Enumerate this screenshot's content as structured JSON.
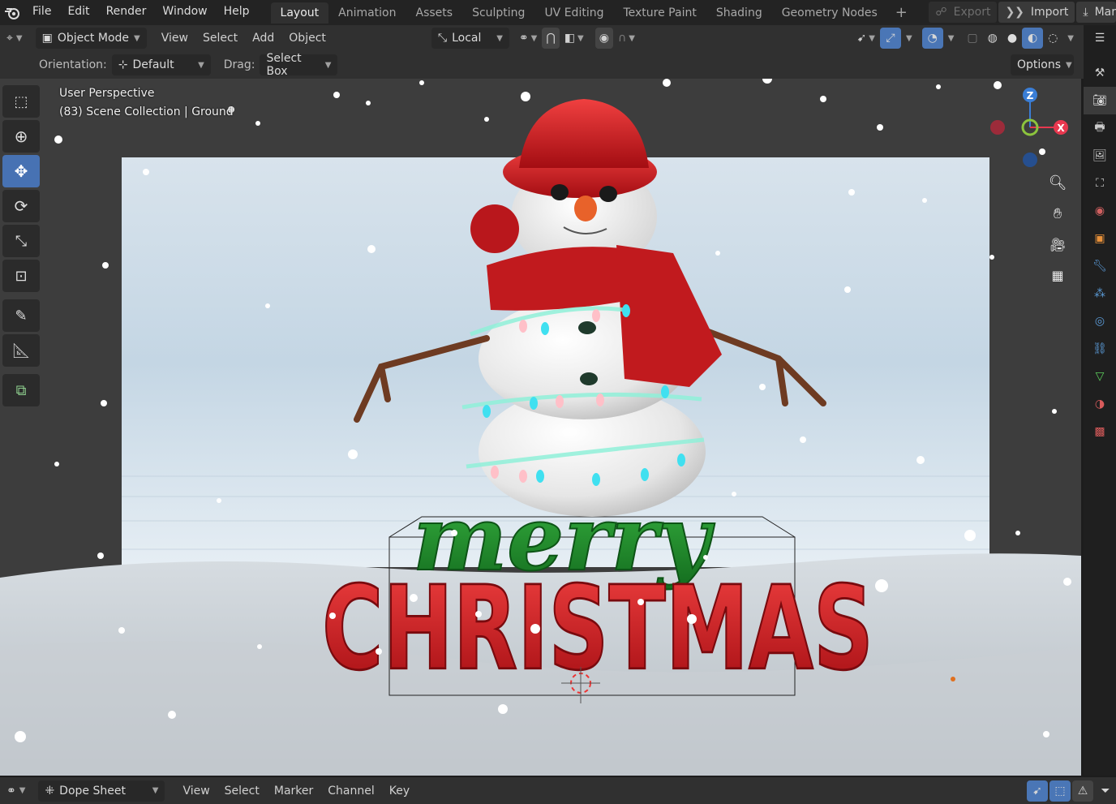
{
  "menu": {
    "items": [
      "File",
      "Edit",
      "Render",
      "Window",
      "Help"
    ]
  },
  "workspaces": {
    "tabs": [
      "Layout",
      "Animation",
      "Assets",
      "Sculpting",
      "UV Editing",
      "Texture Paint",
      "Shading",
      "Geometry Nodes"
    ],
    "active": "Layout"
  },
  "top_right": {
    "export_label": "Export",
    "import_label": "Import",
    "extra_label": "Mar"
  },
  "header": {
    "mode_label": "Object Mode",
    "menus": [
      "View",
      "Select",
      "Add",
      "Object"
    ],
    "transform_orientation": "Local"
  },
  "tool_settings": {
    "orientation_label": "Orientation:",
    "orientation_value": "Default",
    "drag_label": "Drag:",
    "drag_value": "Select Box",
    "options_label": "Options"
  },
  "viewport": {
    "view_name": "User Perspective",
    "collection_info": "(83) Scene Collection | Ground",
    "axis_x": "X",
    "axis_y": "Y",
    "axis_z": "Z",
    "text_merry": "merry",
    "text_christmas": "CHRISTMAS"
  },
  "bottom": {
    "editor_label": "Dope Sheet",
    "menus": [
      "View",
      "Select",
      "Marker",
      "Channel",
      "Key"
    ]
  },
  "colors": {
    "accent_blue": "#4772b3",
    "axis_x": "#e8384f",
    "axis_y": "#8cc43d",
    "axis_z": "#3a7ed6"
  }
}
